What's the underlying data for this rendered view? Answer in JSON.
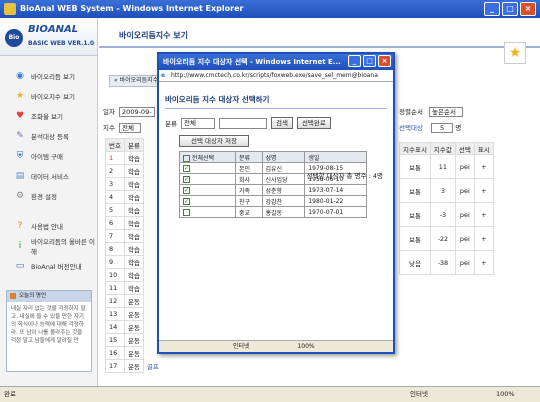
{
  "window": {
    "title": "BioAnal WEB System - Windows Internet Explorer"
  },
  "logo": {
    "brand": "BIOANAL",
    "version": "BASIC WEB VER.1.0",
    "circle": "Bio"
  },
  "sidebar": {
    "items": [
      {
        "label": "바이오리듬 보기",
        "icon": "globe-icon",
        "color": "#3a7ad8",
        "glyph": "◉"
      },
      {
        "label": "바이오지수 보기",
        "icon": "star-icon",
        "color": "#f0b020",
        "glyph": "★"
      },
      {
        "label": "조화율 보기",
        "icon": "heart-icon",
        "color": "#e04040",
        "glyph": "♥"
      },
      {
        "label": "분석대상 등록",
        "icon": "pencil-icon",
        "color": "#8060c0",
        "glyph": "✎"
      },
      {
        "label": "아이템 구매",
        "icon": "shield-icon",
        "color": "#2a60c0",
        "glyph": "⛨"
      },
      {
        "label": "데이터 서비스",
        "icon": "data-icon",
        "color": "#4a90d0",
        "glyph": "▤"
      },
      {
        "label": "환경 설정",
        "icon": "gear-icon",
        "color": "#808080",
        "glyph": "⚙"
      },
      {
        "label": "사용법 안내",
        "icon": "help-icon",
        "color": "#e08020",
        "glyph": "?"
      },
      {
        "label": "바이오리듬의 올바른 이해",
        "icon": "info-icon",
        "color": "#2a8a2a",
        "glyph": "i"
      },
      {
        "label": "BioAnal 버전안내",
        "icon": "monitor-icon",
        "color": "#3a6ab8",
        "glyph": "▭"
      }
    ]
  },
  "notice": {
    "title": "오늘의 명언",
    "text": "내실 자리 없는 것을 걱정하지 말고, 내실에 들 수 있을 만한 자기의 학식이나 능력에 대해 걱정하라. 또 남이 나를 몰라주는 것을 걱정 말고 남들에게 알려질 만"
  },
  "main": {
    "header": "바이오리듬지수 보기",
    "tab": "« 바이오리듬지수",
    "date_label": "일자",
    "date_value": "2009-09-",
    "index_label": "지수",
    "index_value": "전체"
  },
  "bg_table": {
    "headers": [
      "번호",
      "분류"
    ],
    "rows": [
      [
        "1",
        "학습"
      ],
      [
        "2",
        "학습"
      ],
      [
        "3",
        "학습"
      ],
      [
        "4",
        "학습"
      ],
      [
        "5",
        "학습"
      ],
      [
        "6",
        "학습"
      ],
      [
        "7",
        "학습"
      ],
      [
        "8",
        "학습"
      ],
      [
        "9",
        "학습"
      ],
      [
        "10",
        "학습"
      ],
      [
        "11",
        "학습"
      ],
      [
        "12",
        "운동"
      ],
      [
        "13",
        "운동"
      ],
      [
        "14",
        "운동"
      ],
      [
        "15",
        "운동"
      ],
      [
        "16",
        "운동"
      ],
      [
        "17",
        "운동"
      ]
    ],
    "last_row_extra": "골프"
  },
  "right": {
    "sort_label": "정렬순서",
    "sort_value": "높은순서",
    "target_label": "선택대상",
    "target_value": "5",
    "target_unit": "명",
    "headers": [
      "지수표시",
      "지수값",
      "선택",
      "표시"
    ],
    "rows": [
      [
        "보통",
        "11",
        "pei",
        "+"
      ],
      [
        "보통",
        "3",
        "pei",
        "+"
      ],
      [
        "보통",
        "-3",
        "pei",
        "+"
      ],
      [
        "보통",
        "-22",
        "pei",
        "+"
      ],
      [
        "낮음",
        "-38",
        "pei",
        "+"
      ]
    ]
  },
  "popup": {
    "title": "바이오리듬 지수 대상자 선택 - Windows Internet E...",
    "url": "http://www.cmctech.co.kr/scripts/foxweb.exe/save_sel_mem@bioana",
    "heading": "바이오리듬 지수 대상자 선택하기",
    "category_label": "분류",
    "category_value": "전체",
    "search_button": "검색",
    "done_button": "선택완료",
    "save_button": "선택 대상자 저장",
    "count_text": "선택한 대상자 총 명수 : 4명",
    "columns": [
      "전체선택",
      "분류",
      "성명",
      "생일"
    ],
    "rows": [
      {
        "checked": true,
        "category": "본인",
        "name": "김유신",
        "birth": "1979-08-15"
      },
      {
        "checked": true,
        "category": "회사",
        "name": "신사임당",
        "birth": "1958-06-10"
      },
      {
        "checked": true,
        "category": "가족",
        "name": "성춘향",
        "birth": "1973-07-14"
      },
      {
        "checked": true,
        "category": "친구",
        "name": "강감찬",
        "birth": "1980-01-22"
      },
      {
        "checked": false,
        "category": "중교",
        "name": "홍길동",
        "birth": "1970-07-01"
      }
    ],
    "status_zone": "인터넷",
    "status_zoom": "100%"
  },
  "statusbar": {
    "left": "완료",
    "zone": "인터넷",
    "zoom": "100%"
  }
}
